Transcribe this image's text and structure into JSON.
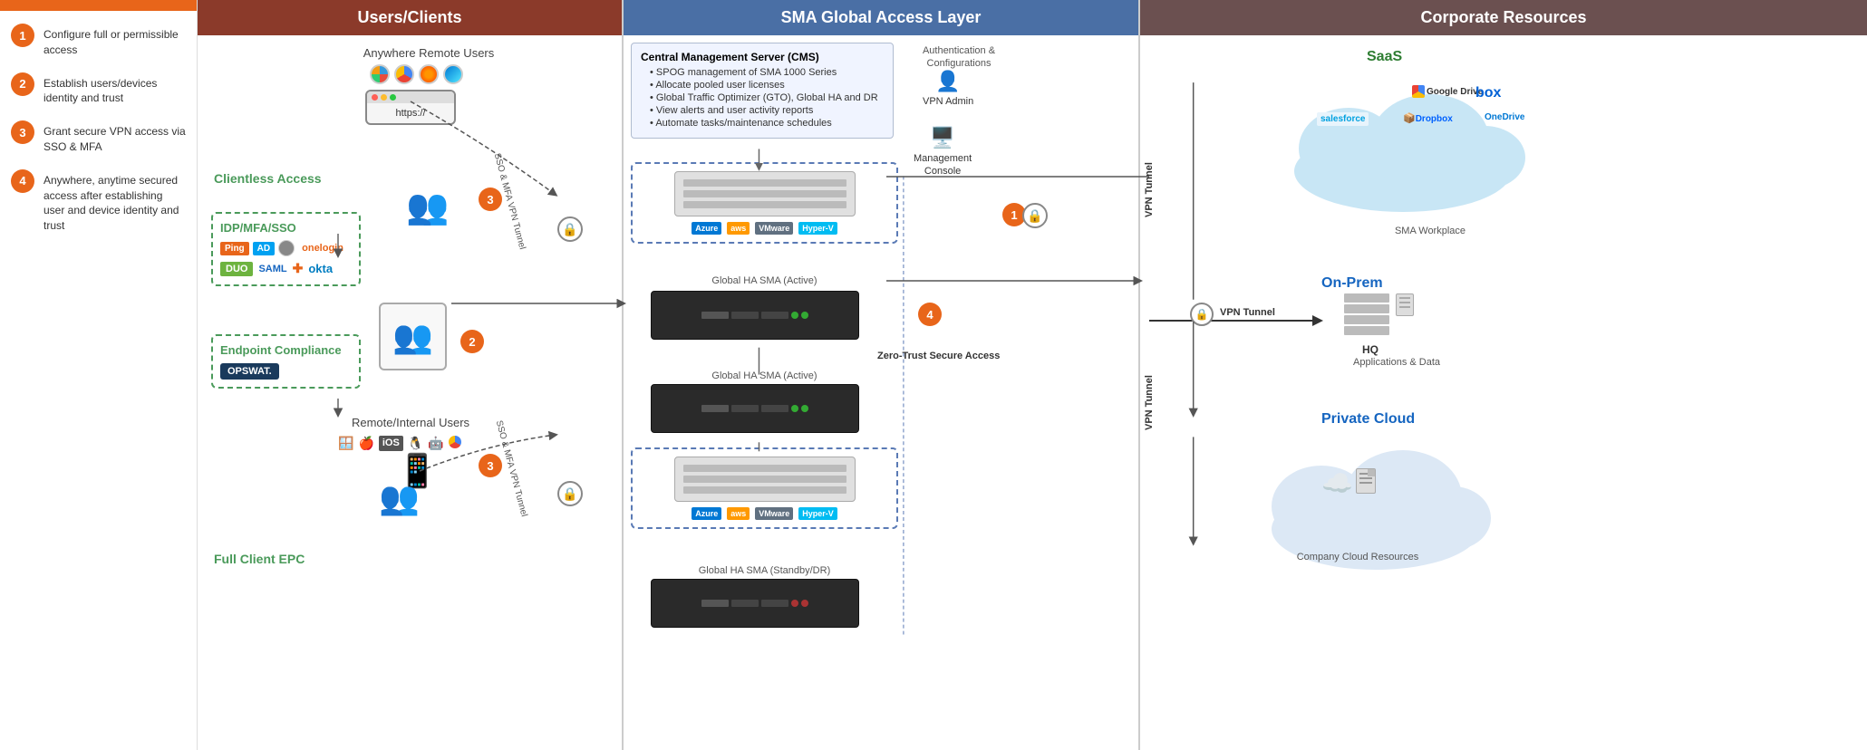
{
  "leftPanel": {
    "steps": [
      {
        "number": "1",
        "text": "Configure full or permissible access"
      },
      {
        "number": "2",
        "text": "Establish users/devices identity and trust"
      },
      {
        "number": "3",
        "text": "Grant secure VPN access via SSO & MFA"
      },
      {
        "number": "4",
        "text": "Anywhere, anytime secured access after establishing user and device identity and trust"
      }
    ]
  },
  "usersSection": {
    "title": "Users/Clients",
    "anywhereRemoteUsers": "Anywhere Remote Users",
    "clientlessAccess": "Clientless Access",
    "browserUrl": "https://",
    "idpTitle": "IDP/MFA/SSO",
    "idpLogos": [
      "Ping",
      "AD",
      "onelogin",
      "DUO",
      "SAML",
      "okta"
    ],
    "endpointCompliance": "Endpoint Compliance",
    "opswat": "OPSWAT.",
    "remoteInternalUsers": "Remote/Internal Users",
    "fullClientEPC": "Full Client EPC"
  },
  "smaSection": {
    "title": "SMA Global Access Layer",
    "cmsTitle": "Central Management Server (CMS)",
    "cmsBullets": [
      "SPOG management of SMA 1000 Series",
      "Allocate pooled user licenses",
      "Global Traffic Optimizer (GTO), Global HA and DR",
      "View alerts and user activity reports",
      "Automate tasks/maintenance schedules"
    ],
    "authLabel": "Authentication &\nConfigurations",
    "vpnAdmin": "VPN Admin",
    "mgmtConsole": "Management\nConsole",
    "globalHAActive1": "Global HA SMA (Active)",
    "globalHAActive2": "Global HA SMA (Active)",
    "globalHAStandby": "Global HA SMA (Standby/DR)",
    "cloudLogos": [
      "Azure",
      "aws",
      "VMware",
      "Hyper-V"
    ]
  },
  "corporateSection": {
    "title": "Corporate Resources",
    "saasLabel": "SaaS",
    "saasLogos": [
      "Google Drive",
      "box",
      "Salesforce",
      "Dropbox",
      "OneDrive"
    ],
    "smaWorkplace": "SMA Workplace",
    "onPremLabel": "On-Prem",
    "vpnTunnel": "VPN Tunnel",
    "hqLabel": "HQ",
    "applicationsData": "Applications & Data",
    "privateCloudLabel": "Private Cloud",
    "companyCloudResources": "Company Cloud Resources",
    "zeroTrustLabel": "Zero-Trust Secure Access"
  },
  "badges": {
    "step1": "1",
    "step2": "2",
    "step3": "3",
    "step4": "4"
  },
  "arrowLabels": {
    "ssoMfa1": "SSO & MFA VPN Tunnel",
    "ssoMfa2": "SSO & MFA VPN Tunnel",
    "vpnTunnel": "VPN Tunnel",
    "vpnTunnel2": "VPN Tunnel"
  }
}
